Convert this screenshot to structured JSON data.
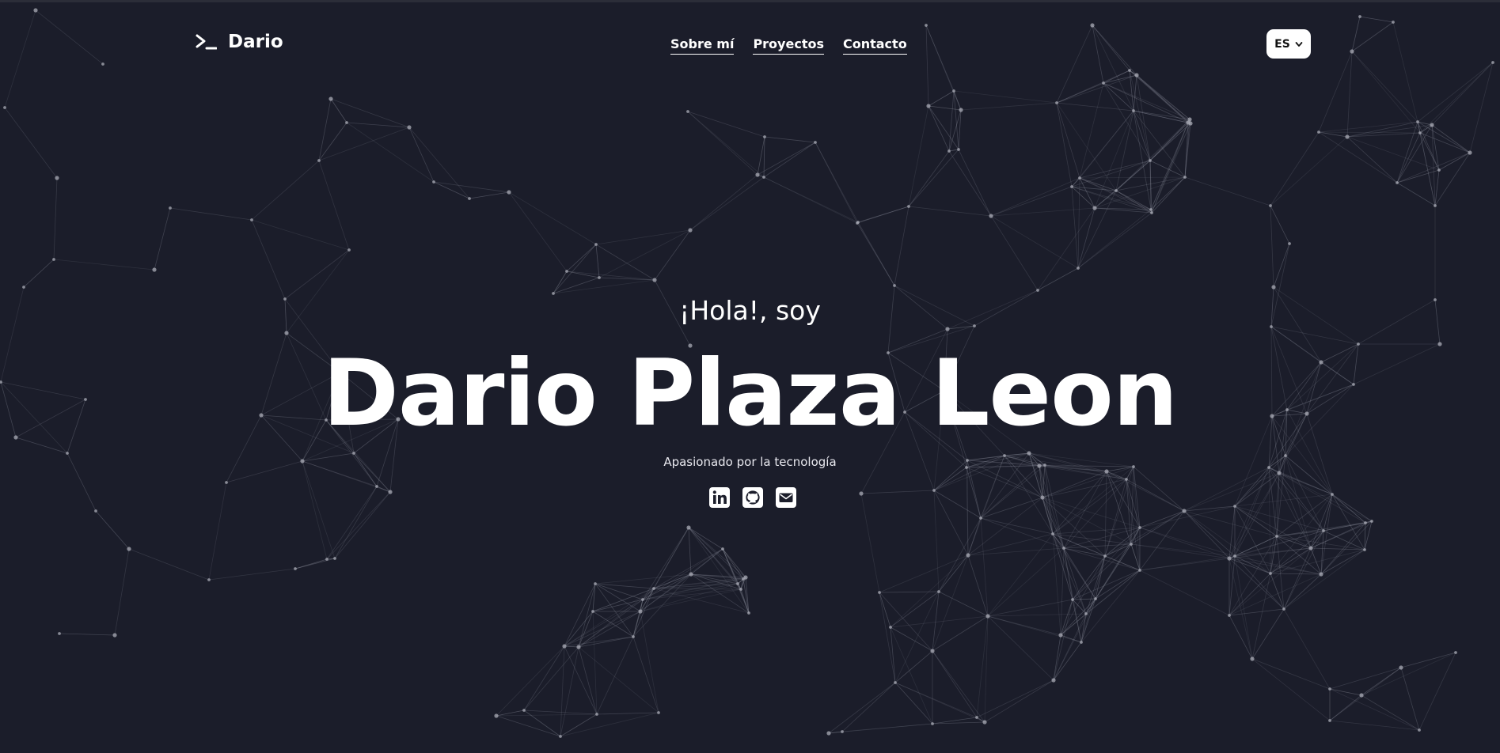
{
  "colors": {
    "background": "#1b1d2a",
    "text": "#ffffff",
    "network_line": "#8a8d9a",
    "network_node": "#a9abb6"
  },
  "header": {
    "brand_icon": "terminal-prompt-icon",
    "brand_name": "Dario",
    "nav": [
      {
        "label": "Sobre mí"
      },
      {
        "label": "Proyectos"
      },
      {
        "label": "Contacto"
      }
    ],
    "language_select": {
      "value": "ES",
      "icon": "chevron-down-icon"
    }
  },
  "hero": {
    "greeting": "¡Hola!, soy",
    "name": "Dario Plaza Leon",
    "tagline": "Apasionado por la tecnología",
    "socials": [
      {
        "name": "LinkedIn",
        "icon": "linkedin-icon"
      },
      {
        "name": "GitHub",
        "icon": "github-icon"
      },
      {
        "name": "Email",
        "icon": "mail-icon"
      }
    ]
  }
}
